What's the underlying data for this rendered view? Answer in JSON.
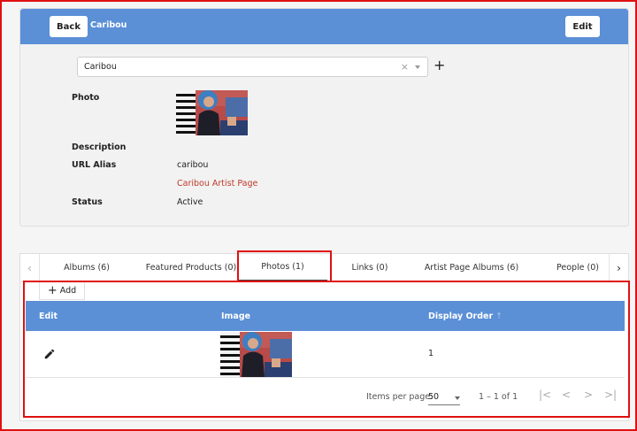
{
  "header": {
    "back_label": "Back",
    "title": "Caribou",
    "edit_label": "Edit"
  },
  "select": {
    "value": "Caribou",
    "clear_glyph": "×"
  },
  "details": {
    "photo_label": "Photo",
    "description_label": "Description",
    "url_alias_label": "URL Alias",
    "url_alias_value": "caribou",
    "artist_page_link": "Caribou Artist Page",
    "status_label": "Status",
    "status_value": "Active"
  },
  "tabs": [
    {
      "label": "Albums (6)"
    },
    {
      "label": "Featured Products (0)"
    },
    {
      "label": "Photos (1)"
    },
    {
      "label": "Links (0)"
    },
    {
      "label": "Artist Page Albums (6)"
    },
    {
      "label": "People (0)"
    }
  ],
  "active_tab": "Photos (1)",
  "tab_prev_glyph": "‹",
  "tab_next_glyph": "›",
  "add_label": "Add",
  "table": {
    "columns": [
      "Edit",
      "Image",
      "Display Order"
    ],
    "sort_glyph": "↑",
    "rows": [
      {
        "display_order": "1"
      }
    ]
  },
  "paginator": {
    "items_per_page_label": "Items per page:",
    "page_size": "50",
    "range": "1 – 1 of 1",
    "first_glyph": "|<",
    "prev_glyph": "<",
    "next_glyph": ">",
    "last_glyph": ">|"
  },
  "colors": {
    "header_blue": "#5b8fd6",
    "link_red": "#c0392b",
    "highlight_red": "#e01010"
  },
  "icons": [
    "plus-icon",
    "pencil-icon",
    "chevron-left-icon",
    "chevron-right-icon",
    "dropdown-arrow-icon"
  ]
}
